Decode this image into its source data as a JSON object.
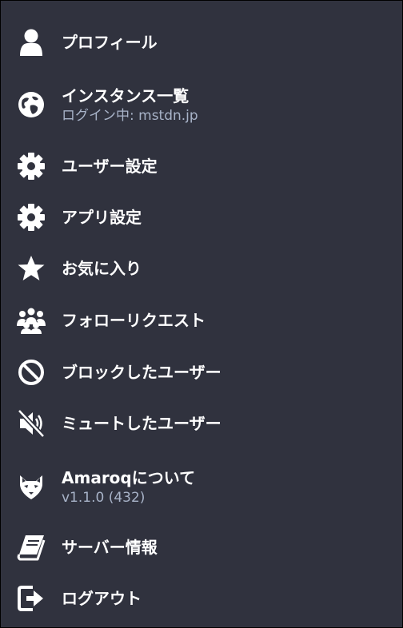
{
  "menu": {
    "items": [
      {
        "label": "プロフィール",
        "icon": "person-icon"
      },
      {
        "label": "インスタンス一覧",
        "sublabel": "ログイン中: mstdn.jp",
        "icon": "globe-icon"
      },
      {
        "label": "ユーザー設定",
        "icon": "gear-icon"
      },
      {
        "label": "アプリ設定",
        "icon": "gear-icon"
      },
      {
        "label": "お気に入り",
        "icon": "star-icon"
      },
      {
        "label": "フォローリクエスト",
        "icon": "users-icon"
      },
      {
        "label": "ブロックしたユーザー",
        "icon": "block-icon"
      },
      {
        "label": "ミュートしたユーザー",
        "icon": "muted-speaker-icon"
      },
      {
        "label": "Amaroqについて",
        "sublabel": "v1.1.0 (432)",
        "icon": "fox-icon"
      },
      {
        "label": "サーバー情報",
        "icon": "book-icon"
      },
      {
        "label": "ログアウト",
        "icon": "sign-out-icon"
      }
    ]
  },
  "colors": {
    "background": "#30323e",
    "text": "#ffffff",
    "subtext": "#a8b3c8"
  }
}
